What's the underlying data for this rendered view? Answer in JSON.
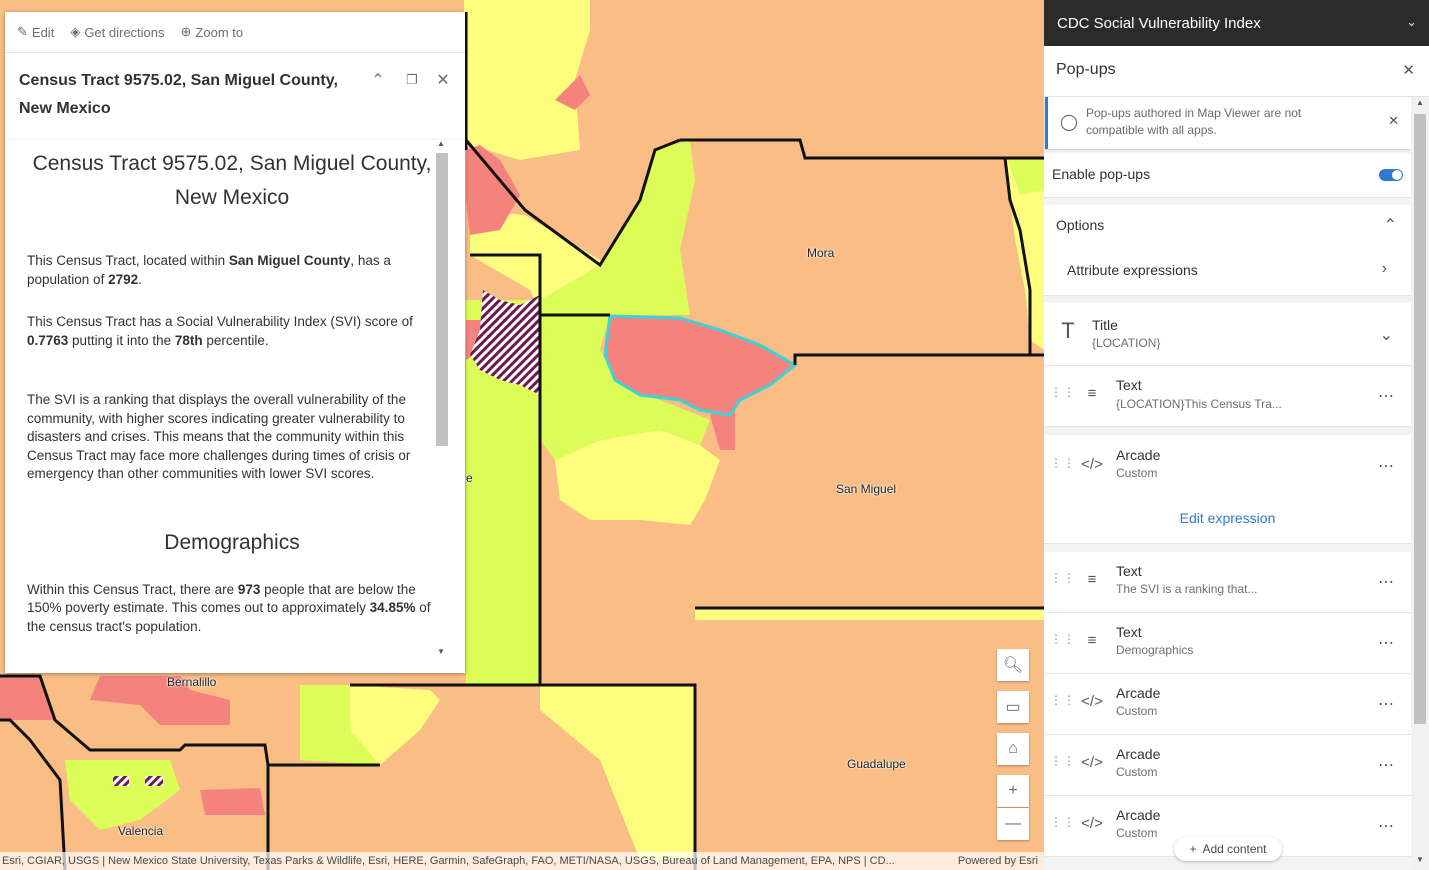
{
  "map": {
    "labels": {
      "mora": "Mora",
      "san_miguel": "San Miguel",
      "guadalupe": "Guadalupe",
      "bernalillo": "Bernalillo",
      "valencia": "Valencia",
      "partial_e": "e"
    },
    "attribution": "Esri, CGIAR, USGS | New Mexico State University, Texas Parks & Wildlife, Esri, HERE, Garmin, SafeGraph, FAO, METI/NASA, USGS, Bureau of Land Management, EPA, NPS | CD...",
    "powered_by": "Powered by Esri",
    "colors": {
      "very_high": "#f4837d",
      "high": "#f9bd85",
      "moderate": "#fdfd7e",
      "low": "#dcfc57",
      "selected_outline": "#3cd2d8"
    },
    "tools": [
      "search-icon",
      "monitor-icon",
      "home-icon",
      "zoom-in-icon",
      "zoom-out-icon"
    ]
  },
  "popup": {
    "actions": {
      "edit": "Edit",
      "directions": "Get directions",
      "zoom": "Zoom to"
    },
    "title": "Census Tract 9575.02, San Miguel County, New Mexico",
    "body": {
      "heading": "Census Tract 9575.02, San Miguel County, New Mexico",
      "p1_a": "This Census Tract, located within ",
      "p1_county": "San Miguel County",
      "p1_b": ", has a population of ",
      "p1_pop": "2792",
      "p1_c": ".",
      "p2_a": "This Census Tract has a Social Vulnerability Index (SVI) score of ",
      "p2_score": "0.7763",
      "p2_b": " putting it into the ",
      "p2_pct": "78th",
      "p2_c": " percentile.",
      "p3": "The SVI is a ranking that displays the overall vulnerability of the community, with higher scores indicating greater vulnerability to disasters and crises. This means that the community within this Census Tract may face more challenges during times of crisis or emergency than other communities with lower SVI scores.",
      "demographics_heading": "Demographics",
      "p4_a": "Within this Census Tract, there are ",
      "p4_num": "973",
      "p4_b": " people that are below the 150% poverty estimate. This comes out to approximately ",
      "p4_pct": "34.85%",
      "p4_c": " of the census tract's population."
    }
  },
  "panel": {
    "layer_title": "CDC Social Vulnerability Index",
    "header": "Pop-ups",
    "notice": "Pop-ups authored in Map Viewer are not compatible with all apps.",
    "enable_label": "Enable pop-ups",
    "enable_on": true,
    "options_label": "Options",
    "attr_expr_label": "Attribute expressions",
    "title_item": {
      "label": "Title",
      "sub": "{LOCATION}"
    },
    "items": [
      {
        "type": "text",
        "label": "Text",
        "sub": "{LOCATION}This Census Tra..."
      },
      {
        "type": "arcade",
        "label": "Arcade",
        "sub": "Custom",
        "action": "Edit expression"
      },
      {
        "type": "text",
        "label": "Text",
        "sub": "The SVI is a ranking that..."
      },
      {
        "type": "text",
        "label": "Text",
        "sub": "Demographics"
      },
      {
        "type": "arcade",
        "label": "Arcade",
        "sub": "Custom"
      },
      {
        "type": "arcade",
        "label": "Arcade",
        "sub": "Custom"
      },
      {
        "type": "arcade",
        "label": "Arcade",
        "sub": "Custom"
      }
    ],
    "add_content": "Add content"
  }
}
